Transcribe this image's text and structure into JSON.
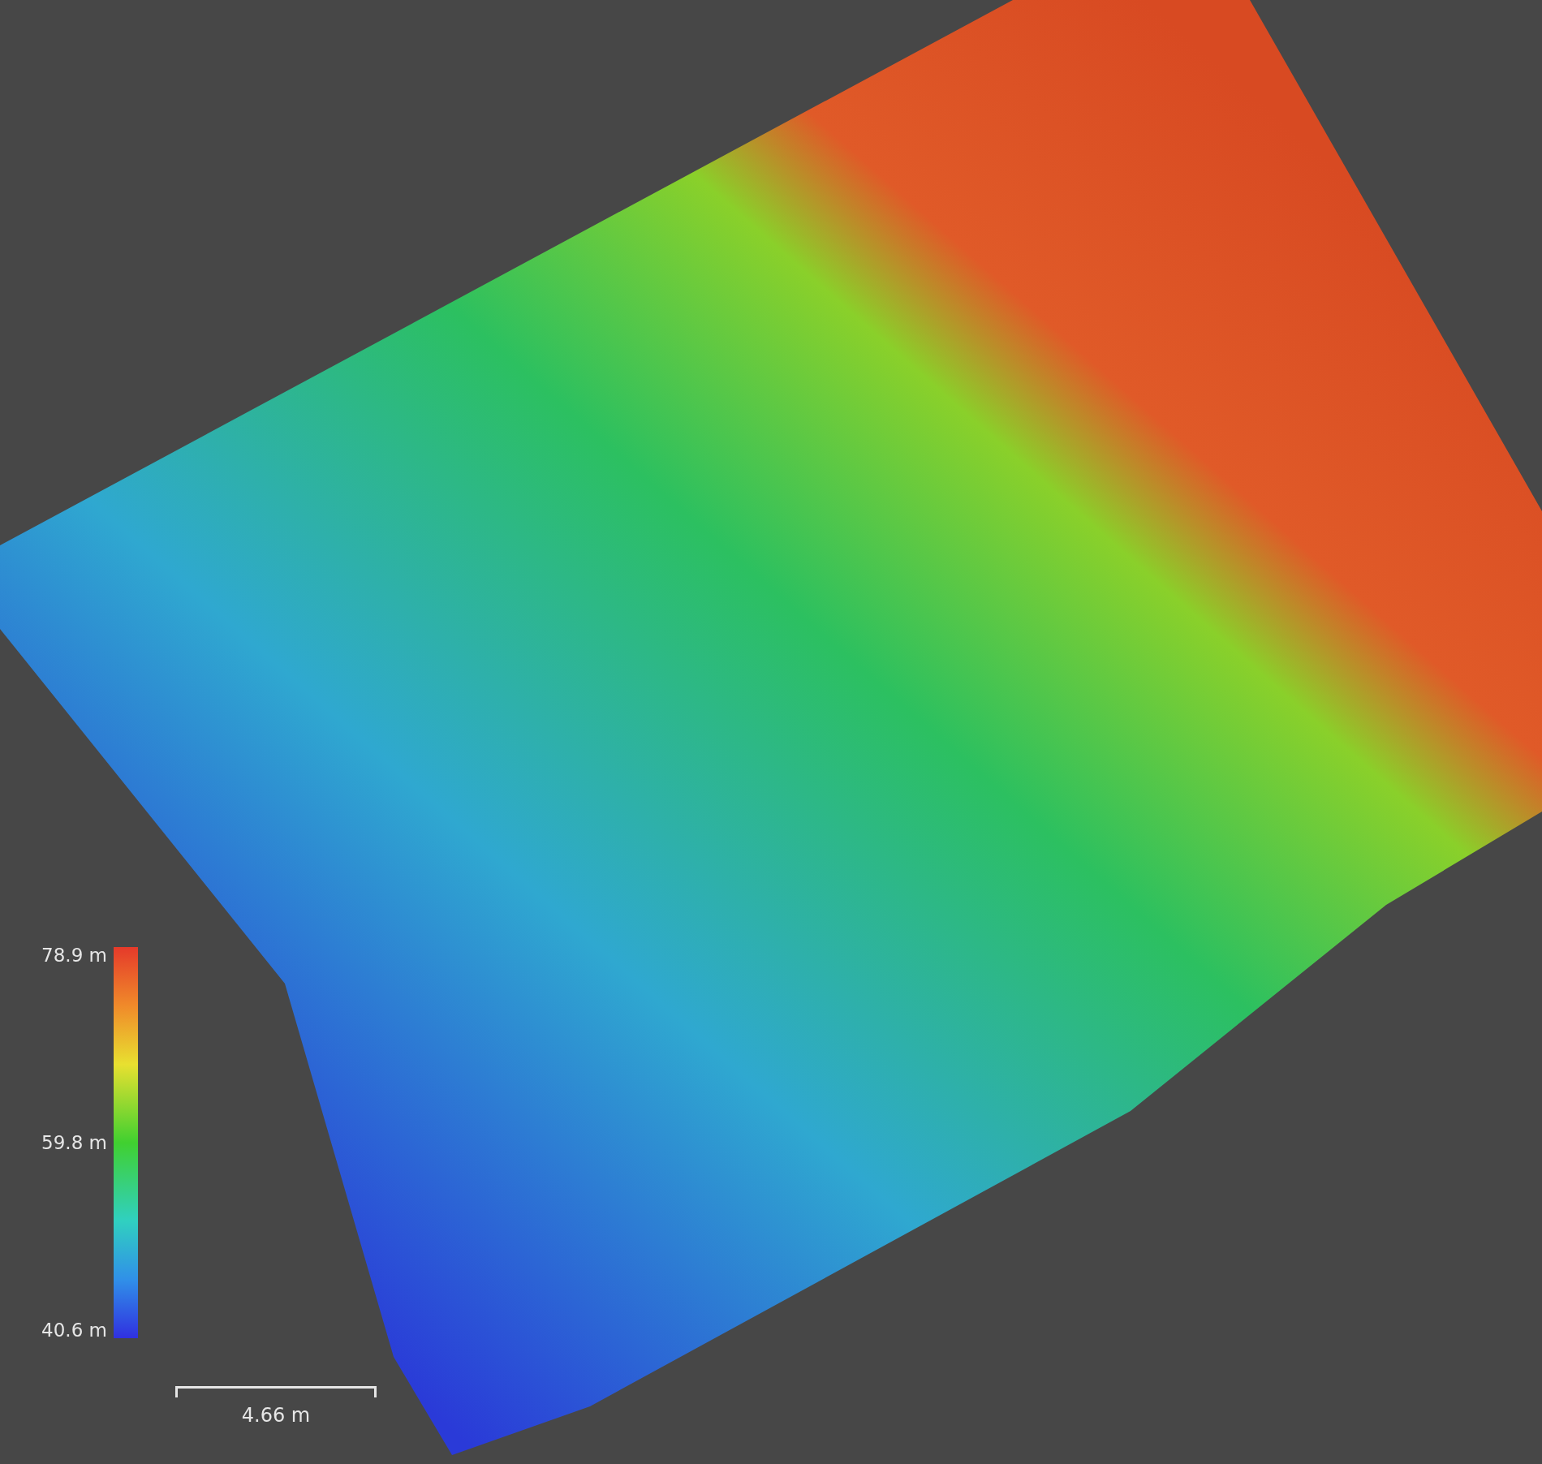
{
  "legend": {
    "labels": [
      "78.9 m",
      "59.8 m",
      "40.6 m"
    ]
  },
  "scale_bar": {
    "label": "4.66 m"
  }
}
